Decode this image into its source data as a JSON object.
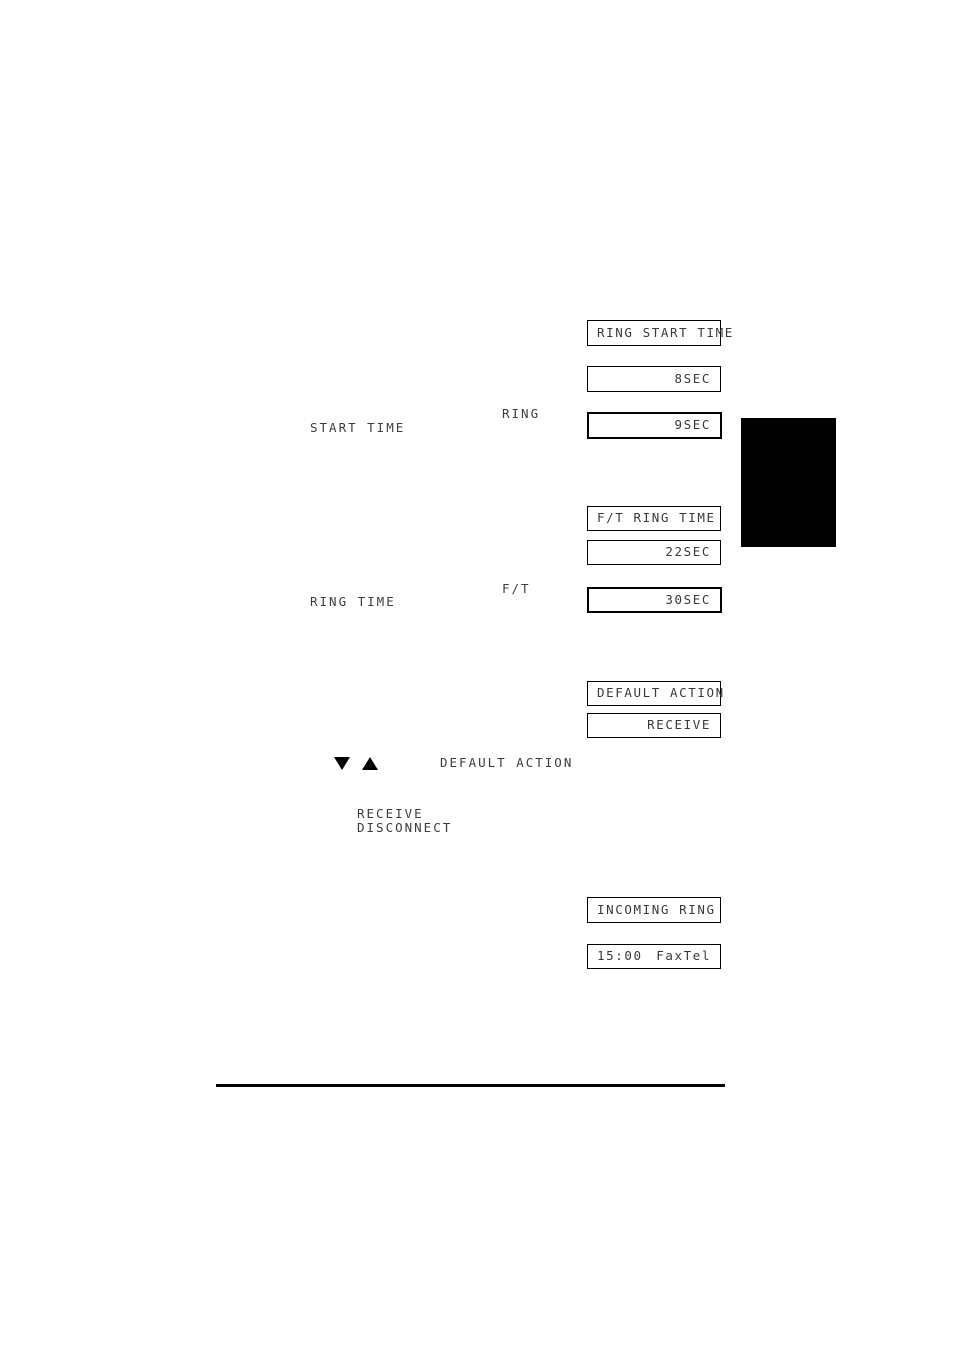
{
  "page": {
    "background": "#ffffff",
    "ink": "#3d3d3d",
    "rule_color": "#000000",
    "tab_color": "#000000"
  },
  "lcd_displays": [
    {
      "id": "ring-start-time-title",
      "align": "left",
      "emphasis": false,
      "text": "RING START TIME"
    },
    {
      "id": "ring-start-time-value-8sec",
      "align": "right",
      "emphasis": false,
      "text": "8SEC"
    },
    {
      "id": "ring-start-time-value-9sec",
      "align": "right",
      "emphasis": true,
      "text": "9SEC"
    },
    {
      "id": "ft-ring-time-title",
      "align": "left",
      "emphasis": false,
      "text": "F/T RING TIME"
    },
    {
      "id": "ft-ring-time-value-22sec",
      "align": "right",
      "emphasis": false,
      "text": "22SEC"
    },
    {
      "id": "ft-ring-time-value-30sec",
      "align": "right",
      "emphasis": false,
      "text": "30SEC"
    },
    {
      "id": "default-action-title",
      "align": "left",
      "emphasis": false,
      "text": "DEFAULT ACTION"
    },
    {
      "id": "default-action-value-receive",
      "align": "right",
      "emphasis": false,
      "text": "RECEIVE"
    },
    {
      "id": "incoming-ring-title",
      "align": "left",
      "emphasis": false,
      "text": "INCOMING RING"
    },
    {
      "id": "standby-display",
      "align": "split",
      "emphasis": false,
      "left_text": "15:00",
      "right_text": "FaxTel"
    }
  ],
  "body_text": {
    "ring_label": "RING",
    "start_time_label": "START TIME",
    "ft_label": "F/T",
    "ring_time_label": "RING TIME",
    "default_action_label": "DEFAULT ACTION",
    "option_receive": "RECEIVE",
    "option_disconnect": "DISCONNECT"
  },
  "icons": {
    "down_arrow": "▼",
    "up_arrow": "▲"
  }
}
